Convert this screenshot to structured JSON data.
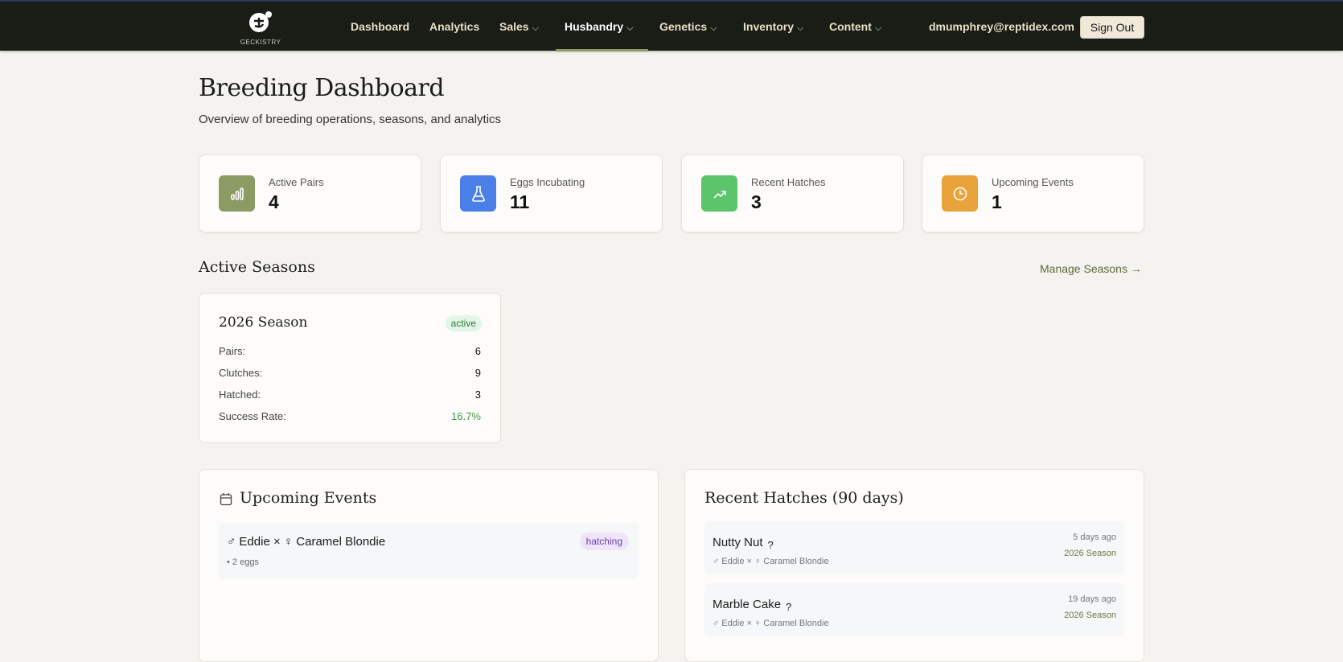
{
  "nav": {
    "logo_text": "GECKISTRY",
    "items": [
      {
        "label": "Dashboard",
        "dropdown": false
      },
      {
        "label": "Analytics",
        "dropdown": false
      },
      {
        "label": "Sales",
        "dropdown": true
      },
      {
        "label": "Husbandry",
        "dropdown": true,
        "active": true
      },
      {
        "label": "Genetics",
        "dropdown": true
      },
      {
        "label": "Inventory",
        "dropdown": true
      },
      {
        "label": "Content",
        "dropdown": true
      }
    ],
    "email": "dmumphrey@reptidex.com",
    "sign_out": "Sign Out"
  },
  "page": {
    "title": "Breeding Dashboard",
    "subtitle": "Overview of breeding operations, seasons, and analytics"
  },
  "stats": [
    {
      "label": "Active Pairs",
      "value": "4",
      "color": "#8c9a63",
      "icon": "bar-chart-icon"
    },
    {
      "label": "Eggs Incubating",
      "value": "11",
      "color": "#4a7fe8",
      "icon": "flask-icon"
    },
    {
      "label": "Recent Hatches",
      "value": "3",
      "color": "#5cc46a",
      "icon": "trending-up-icon"
    },
    {
      "label": "Upcoming Events",
      "value": "1",
      "color": "#eaa23a",
      "icon": "clock-icon"
    }
  ],
  "seasons": {
    "heading": "Active Seasons",
    "manage": "Manage Seasons →",
    "cards": [
      {
        "name": "2026 Season",
        "status": "active",
        "rows": [
          {
            "label": "Pairs:",
            "value": "6"
          },
          {
            "label": "Clutches:",
            "value": "9"
          },
          {
            "label": "Hatched:",
            "value": "3"
          },
          {
            "label": "Success Rate:",
            "value": "16.7%"
          }
        ]
      }
    ]
  },
  "events": {
    "heading": "Upcoming Events",
    "items": [
      {
        "title": "♂ Eddie × ♀ Caramel Blondie",
        "detail": "• 2 eggs",
        "badge": "hatching"
      }
    ]
  },
  "hatches": {
    "heading": "Recent Hatches (90 days)",
    "items": [
      {
        "name": "Nutty Nut",
        "sex": "?",
        "parents": "♂ Eddie × ♀ Caramel Blondie",
        "ago": "5 days ago",
        "season": "2026 Season"
      },
      {
        "name": "Marble Cake",
        "sex": "?",
        "parents": "♂ Eddie × ♀ Caramel Blondie",
        "ago": "19 days ago",
        "season": "2026 Season"
      }
    ]
  }
}
